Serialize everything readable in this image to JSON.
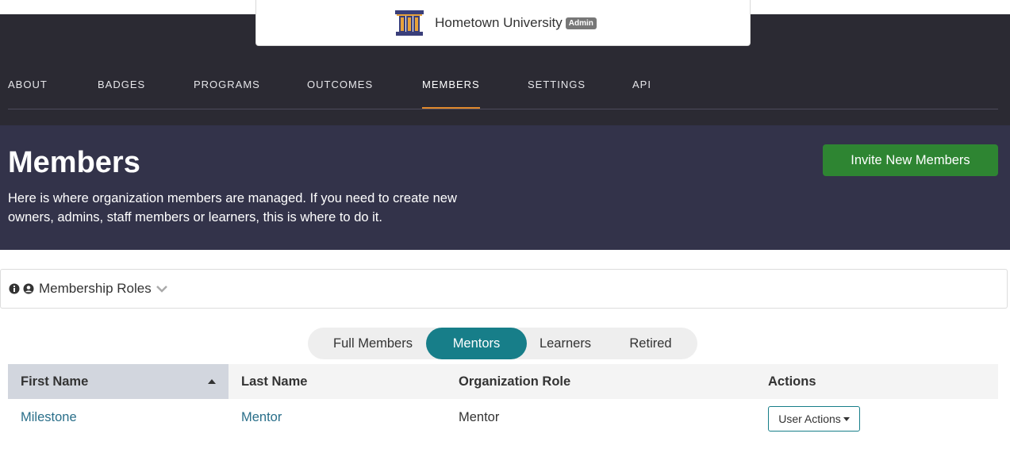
{
  "org": {
    "name": "Hometown University",
    "badge": "Admin",
    "logo_icon": "university-pillars-icon"
  },
  "nav": {
    "tabs": [
      "ABOUT",
      "BADGES",
      "PROGRAMS",
      "OUTCOMES",
      "MEMBERS",
      "SETTINGS",
      "API"
    ],
    "active": "MEMBERS"
  },
  "header": {
    "title": "Members",
    "description": "Here is where organization members are managed. If you need to create new owners, admins, staff members or learners, this is where to do it.",
    "invite_label": "Invite New Members"
  },
  "roles": {
    "label": "Membership Roles",
    "icons": [
      "info-circle-icon",
      "user-circle-icon",
      "chevron-down-icon"
    ]
  },
  "filter": {
    "options": [
      "Full Members",
      "Mentors",
      "Learners",
      "Retired"
    ],
    "active": "Mentors"
  },
  "table": {
    "columns": [
      "First Name",
      "Last Name",
      "Organization Role",
      "Actions"
    ],
    "sorted_column": "First Name",
    "sort_direction": "ascending",
    "rows": [
      {
        "first_name": "Milestone",
        "last_name": "Mentor",
        "role": "Mentor",
        "action_label": "User Actions"
      }
    ]
  },
  "colors": {
    "nav_bg": "#2b2a33",
    "header_bg": "#33334a",
    "accent_green": "#2e8532",
    "accent_teal": "#177e89",
    "active_tab_underline": "#e0892c",
    "link": "#2a6f8a"
  }
}
